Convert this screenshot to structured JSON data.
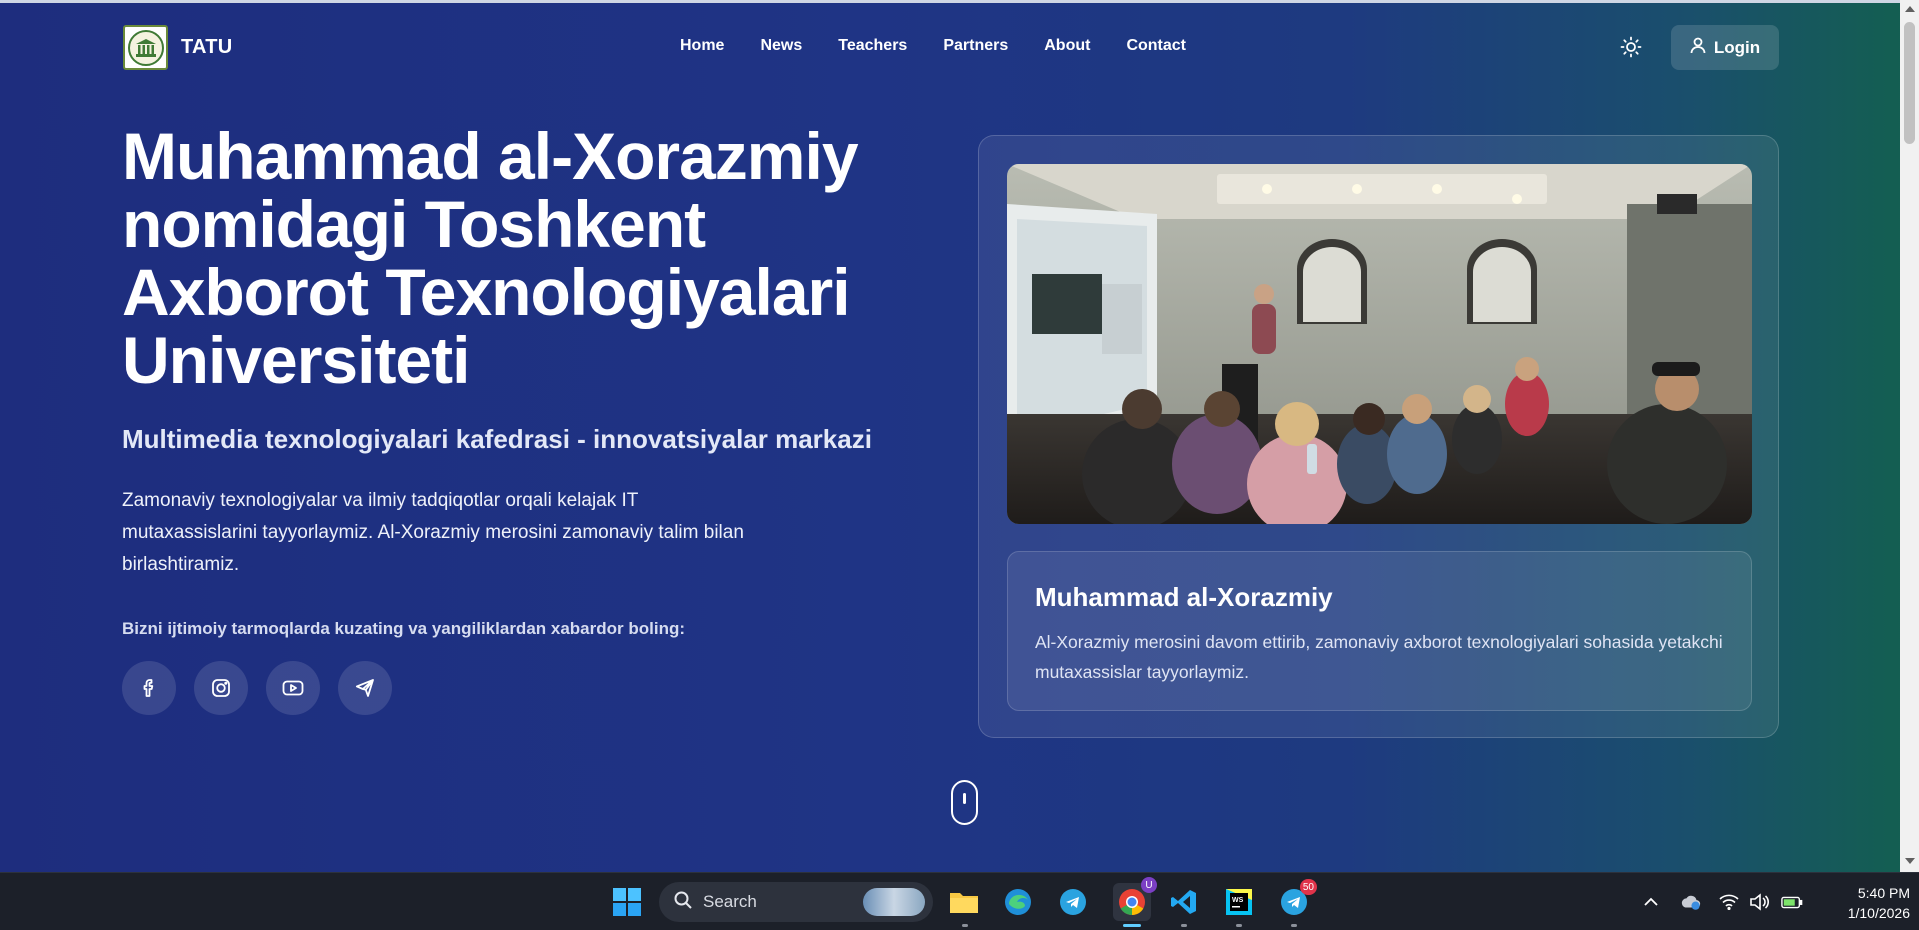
{
  "nav": {
    "brand": "TATU",
    "links": [
      "Home",
      "News",
      "Teachers",
      "Partners",
      "About",
      "Contact"
    ],
    "login_label": "Login"
  },
  "hero": {
    "title": "Muhammad al-Xorazmiy nomidagi Toshkent Axborot Texnologiyalari Universiteti",
    "subtitle": "Multimedia texnologiyalari kafedrasi - innovatsiyalar markazi",
    "description": "Zamonaviy texnologiyalar va ilmiy tadqiqotlar orqali kelajak IT mutaxassislarini tayyorlaymiz. Al-Xorazmiy merosini zamonaviy talim bilan birlashtiramiz.",
    "social_label": "Bizni ijtimoiy tarmoqlarda kuzating va yangiliklardan xabardor boling:",
    "social_icons": [
      "facebook-icon",
      "instagram-icon",
      "youtube-icon",
      "telegram-icon"
    ]
  },
  "card": {
    "title": "Muhammad al-Xorazmiy",
    "text": "Al-Xorazmiy merosini davom ettirib, zamonaviy axborot texnologiyalari sohasida yetakchi mutaxassislar tayyorlaymiz."
  },
  "taskbar": {
    "search_placeholder": "Search",
    "telegram_badge": "50",
    "chrome_badge": "U",
    "time": "5:40 PM",
    "date": "1/10/2026"
  },
  "colors": {
    "bg_left": "#1e2d7e",
    "bg_right": "#13604f",
    "accent_blue": "#60cdff"
  }
}
